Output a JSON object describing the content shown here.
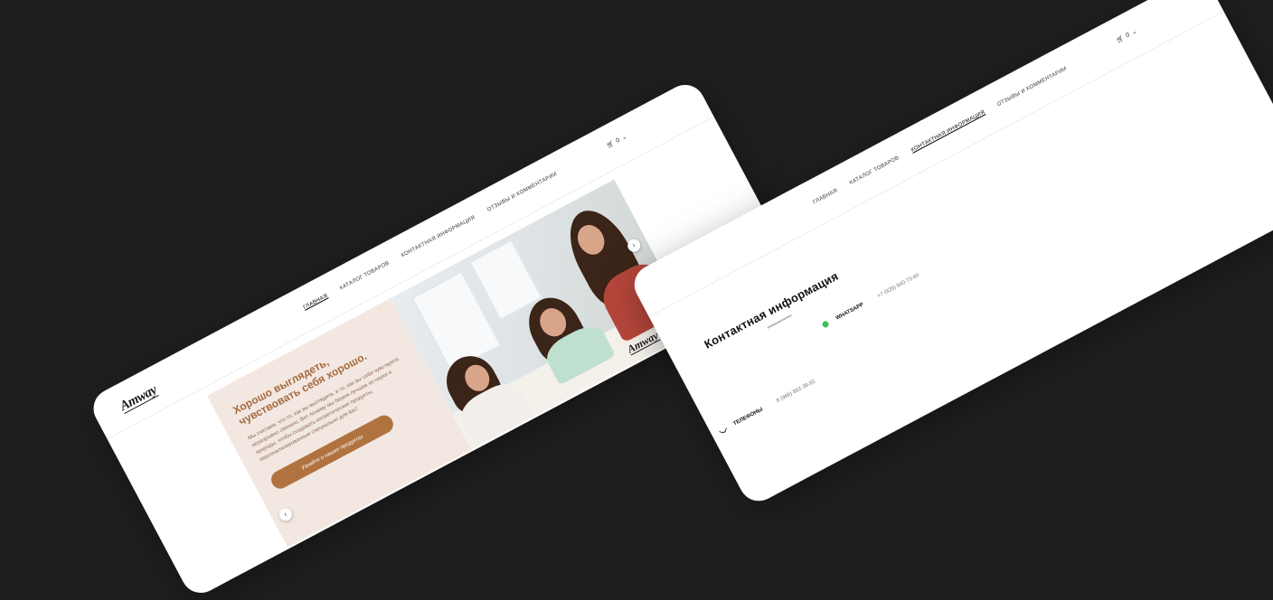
{
  "home_page": {
    "logo": "Amway",
    "menu": [
      {
        "label": "Главная",
        "active": true
      },
      {
        "label": "Каталог товаров",
        "active": false
      },
      {
        "label": "Контактная информация",
        "active": false
      },
      {
        "label": "Отзывы и комментарии",
        "active": false
      }
    ],
    "cart_count": "0",
    "hero": {
      "title": "Хорошо выглядеть, чувствовать себя хорошо.",
      "description": "Мы считаем, что то, как вы выглядите, и то, как вы себя чувствуете, неразрывно связано. Вот почему мы берем лучшее из науки и природы, чтобы создавать косметические продукты, персонализированные специально для вас!",
      "button_label": "Узнайте о наших продуктах",
      "prev_arrow": "‹",
      "next_arrow": "›",
      "photo_logo": "Amway"
    }
  },
  "contacts_page": {
    "menu": [
      {
        "label": "Главная",
        "active": false
      },
      {
        "label": "Каталог товаров",
        "active": false
      },
      {
        "label": "Контактная информация",
        "active": true
      },
      {
        "label": "Отзывы и комментарии",
        "active": false
      }
    ],
    "cart_count": "0",
    "title": "Контактная информация",
    "whatsapp": {
      "label": "WhatsApp",
      "value": "+7 (926) 840-73-60"
    },
    "phones": {
      "label": "Телефоны",
      "value": "8 (969) 892-38-81"
    }
  },
  "colors": {
    "background": "#1f1f1f",
    "hero_panel": "#f3e8e1",
    "accent": "#b0733f",
    "title_brown": "#a46a3e"
  },
  "icons": [
    "cart-icon",
    "chevron-down-icon",
    "chevron-left-icon",
    "chevron-right-icon",
    "whatsapp-icon",
    "phone-icon"
  ]
}
